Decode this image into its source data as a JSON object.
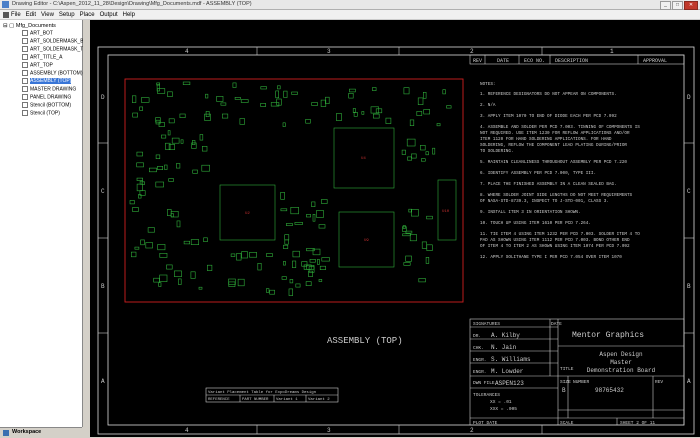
{
  "window": {
    "title": "Drawing Editor - C:\\Aspen_2012_11_28\\Design\\Drawing\\Mfg_Documents.mdf - ASSEMBLY (TOP)",
    "buttons": [
      "_",
      "□",
      "✕"
    ]
  },
  "menu": [
    "File",
    "Edit",
    "View",
    "Setup",
    "Place",
    "Output",
    "Help"
  ],
  "tree": {
    "root": "Mfg_Documents",
    "items": [
      "ART_BOT",
      "ART_SOLDERMASK_B",
      "ART_SOLDERMASK_T",
      "ART_TITLE_A",
      "ART_TOP",
      "ASSEMBLY (BOTTOM)",
      "ASSEMBLY (TOP)",
      "MASTER DRAWING",
      "PANEL DRAWING",
      "Stencil (BOTTOM)",
      "Stencil (TOP)"
    ],
    "selected_index": 6
  },
  "workspace_tab": "Workspace",
  "drawing": {
    "zone_cols_top": [
      "4",
      "3",
      "2",
      "1"
    ],
    "zone_rows": [
      "D",
      "C",
      "B",
      "A"
    ],
    "rev_headers": [
      "REV",
      "DATE",
      "ECO NO.",
      "DESCRIPTION",
      "APPROVAL"
    ],
    "notes_title": "NOTES:",
    "notes": [
      "1.   REFERENCE DESIGNATORS DO NOT APPEAR ON COMPONENTS.",
      "2.   N/A",
      "3.   APPLY ITEM 1070 TO END OF DIODE EACH PER PCD 7.092",
      "4.   ASSEMBLE AND SOLDER PER PCD 7.003. TINNING OF COMPONENTS IS",
      "      NOT REQUIRED. USE ITEM 1230 FOR REFLOW APPLICATIONS AND/OR",
      "      ITEM 1120 FOR HAND SOLDERING APPLICATIONS. FOR HAND",
      "      SOLDERING, REFLOW THE COMPONENT LEAD PLATING DURING/PRIOR",
      "      TO SOLDERING.",
      "5.   MAINTAIN CLEANLINESS THROUGHOUT ASSEMBLY PER PCD 7.220",
      "6.   IDENTIFY ASSEMBLY PER PCD 7.000, TYPE III.",
      "7.   PLACE THE FINISHED ASSEMBLY IN A CLEAN SEALED BAG.",
      "8.   WHERE SOLDER JOINT SIDE LENGTHS DO NOT MEET REQUIREMENTS",
      "      OF NASA-STD-8739.3, INSPECT TO J-STD-001, CLASS 3.",
      "9.   INSTALL ITEM 3 IN ORIENTATION SHOWN.",
      "10.  TOUCH UP USING ITEM 1610 PER PCD 7.264.",
      "11.  TIE ITEM 4 USING ITEM 1232 PER PCD 7.003. SOLDER ITEM 4 TO",
      "      PAD AS SHOWN USING ITEM 1112 PER PCD 7.003. BOND OTHER END",
      "      OF ITEM 4 TO ITEM 2 AS SHOWN USING ITEM 1074 PER PCD 7.092",
      "12.  APPLY SOLITHANE TYPE I PER PCD 7.054 OVER ITEM 1070"
    ],
    "assembly_label": "ASSEMBLY (TOP)",
    "chip_labels": [
      "U2",
      "U4",
      "U9",
      "U10"
    ],
    "title_block": {
      "signatures": "SIGNATURES",
      "date": "DATE",
      "company": "Mentor Graphics",
      "rows": [
        {
          "role": "DR.",
          "name": "A. Kilby"
        },
        {
          "role": "CHK.",
          "name": "N. Jain"
        },
        {
          "role": "ENGR.",
          "name": "S. Williams"
        },
        {
          "role": "ENGR.",
          "name": "M. Lowder"
        }
      ],
      "dwn_file_label": "DWN FILE",
      "dwn_file": "ASPEN123",
      "title_label": "TITLE",
      "title_lines": [
        "Aspen Design",
        "Master",
        "Demonstration Board"
      ],
      "tolerances_label": "TOLERANCES",
      "tol1": "XX = .01",
      "tol2": "XXX = .005",
      "size_label": "SIZE",
      "size": "B",
      "number_label": "NUMBER",
      "number": "98765432",
      "rev_label": "REV",
      "plot_date": "PLOT DATE",
      "scale": "SCALE",
      "sheet": "SHEET 2 OF 11"
    },
    "variant_table": {
      "title": "Variant Placement Table for ExpoDreams Design",
      "cols": [
        "REFERENCE",
        "PART NUMBER",
        "Variant 1",
        "Variant 2"
      ]
    }
  }
}
